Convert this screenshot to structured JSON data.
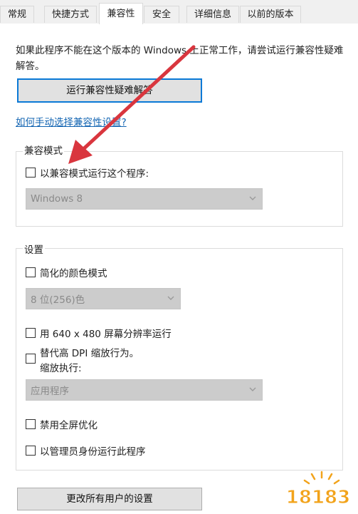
{
  "tabs": [
    "常规",
    "快捷方式",
    "兼容性",
    "安全",
    "详细信息",
    "以前的版本"
  ],
  "active_tab": "兼容性",
  "description": "如果此程序不能在这个版本的 Windows 上正常工作，请尝试运行兼容性疑难解答。",
  "troubleshoot_button": "运行兼容性疑难解答",
  "manual_link": "如何手动选择兼容性设置?",
  "compat_group": {
    "title": "兼容模式",
    "checkbox_label": "以兼容模式运行这个程序:",
    "os_value": "Windows 8"
  },
  "settings_group": {
    "title": "设置",
    "reduced_color_label": "简化的颜色模式",
    "color_value": "8 位(256)色",
    "resolution_label": "用 640 x 480 屏幕分辨率运行",
    "dpi_label_line1": "替代高 DPI 缩放行为。",
    "dpi_label_line2": "缩放执行:",
    "dpi_value": "应用程序",
    "fullscreen_label": "禁用全屏优化",
    "admin_label": "以管理员身份运行此程序"
  },
  "all_users_button": "更改所有用户的设置",
  "watermark": "18183",
  "colors": {
    "arrow": "#d9363e",
    "primary_border": "#0a79d6",
    "link": "#1264b2",
    "watermark": "#f2a31b"
  },
  "icons": {
    "dropdown": "chevron-down-icon"
  }
}
